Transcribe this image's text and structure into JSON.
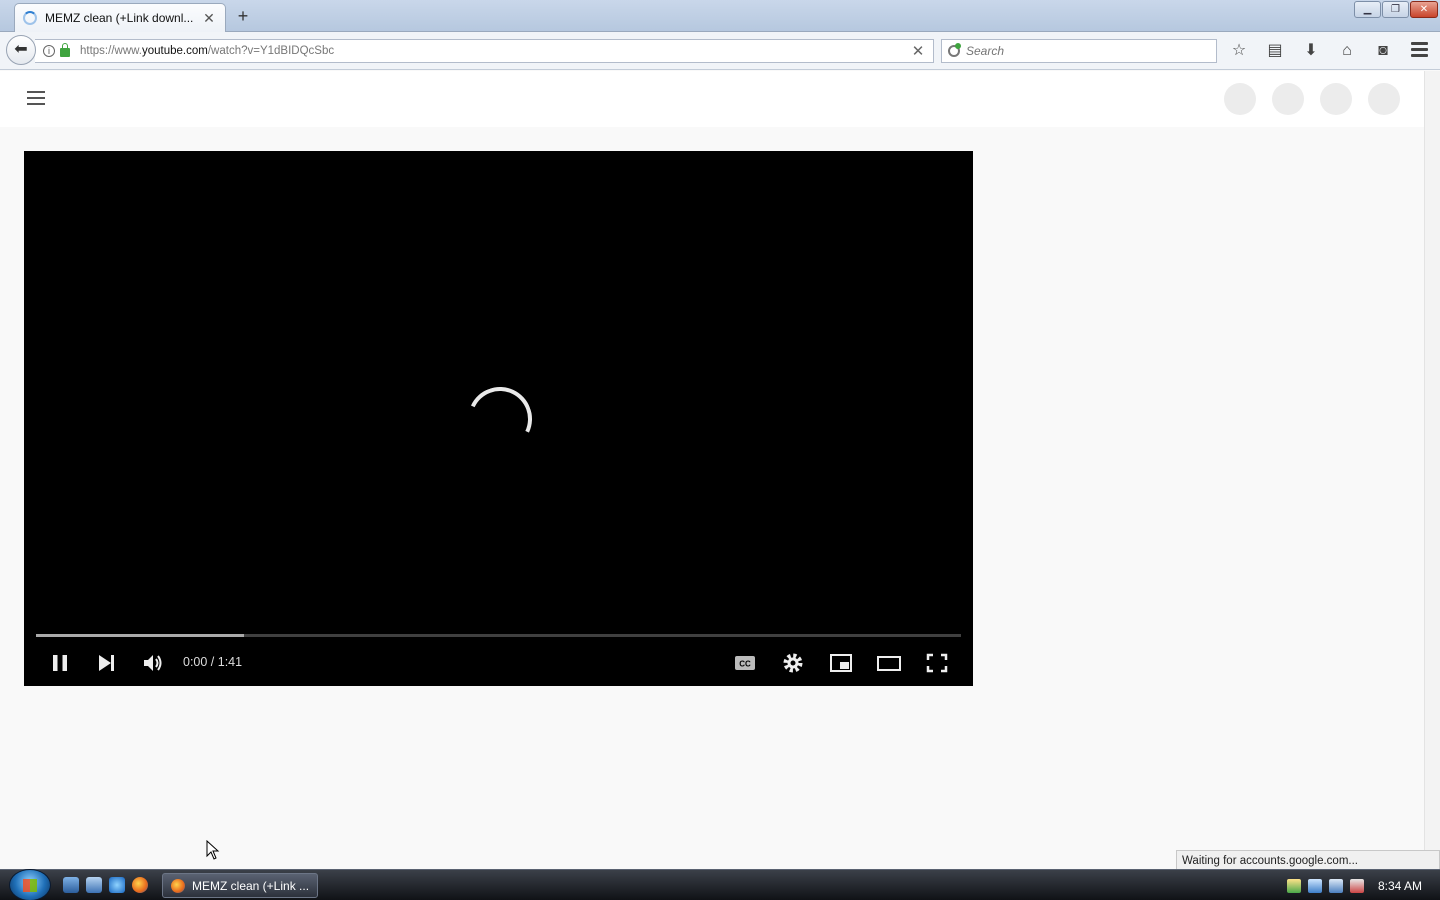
{
  "browser": {
    "tab_title": "MEMZ clean (+Link downl...",
    "url_prefix": "https://www.",
    "url_domain": "youtube.com",
    "url_path": "/watch?v=Y1dBIDQcSbc",
    "search_placeholder": "Search",
    "toolbar_icons": [
      "bookmark-star-icon",
      "reading-list-icon",
      "download-icon",
      "home-icon",
      "pocket-icon",
      "menu-icon"
    ]
  },
  "player": {
    "time_display": "0:00 / 1:41",
    "buffered_fraction": 0.225,
    "controls": [
      "pause-icon",
      "next-icon",
      "volume-icon",
      "captions-icon",
      "settings-icon",
      "miniplayer-icon",
      "theater-mode-icon",
      "fullscreen-icon"
    ]
  },
  "status": {
    "text": "Waiting for accounts.google.com..."
  },
  "taskbar": {
    "task_label": "MEMZ clean (+Link ...",
    "clock": "8:34 AM"
  }
}
